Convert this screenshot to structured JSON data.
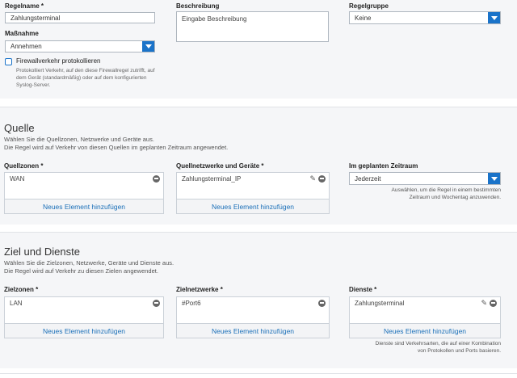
{
  "top": {
    "rule_name_label": "Regelname *",
    "rule_name_value": "Zahlungsterminal",
    "description_label": "Beschreibung",
    "description_placeholder": "Eingabe Beschreibung",
    "group_label": "Regelgruppe",
    "group_value": "Keine",
    "action_label": "Maßnahme",
    "action_value": "Annehmen",
    "log_label": "Firewallverkehr protokollieren",
    "log_desc_1": "Protokolliert Verkehr, auf den diese Firewallregel zutrifft, auf",
    "log_desc_2": "dem Gerät (standardmäßig) oder auf dem konfigurierten",
    "log_desc_3": "Syslog-Server."
  },
  "source": {
    "title": "Quelle",
    "desc_1": "Wählen Sie die Quellzonen, Netzwerke und Geräte aus.",
    "desc_2": "Die Regel wird auf Verkehr von diesen Quellen im geplanten Zeitraum angewendet.",
    "zones_label": "Quellzonen *",
    "zones_item": "WAN",
    "networks_label": "Quellnetzwerke und Geräte *",
    "networks_item": "Zahlungsterminal_IP",
    "schedule_label": "Im geplanten Zeitraum",
    "schedule_value": "Jederzeit",
    "schedule_note_1": "Auswählen, um die Regel in einem bestimmten",
    "schedule_note_2": "Zeitraum und Wochentag anzuwenden.",
    "add_label": "Neues Element hinzufügen"
  },
  "dest": {
    "title": "Ziel und Dienste",
    "desc_1": "Wählen Sie die Zielzonen, Netzwerke, Geräte und Dienste aus.",
    "desc_2": "Die Regel wird auf Verkehr zu diesen Zielen angewendet.",
    "zones_label": "Zielzonen *",
    "zones_item": "LAN",
    "networks_label": "Zielnetzwerke *",
    "networks_item": "#Port6",
    "services_label": "Dienste *",
    "services_item": "Zahlungsterminal",
    "services_note_1": "Dienste sind Verkehrsarten, die auf einer Kombination",
    "services_note_2": "von Protokollen und Ports basieren.",
    "add_label": "Neues Element hinzufügen"
  }
}
